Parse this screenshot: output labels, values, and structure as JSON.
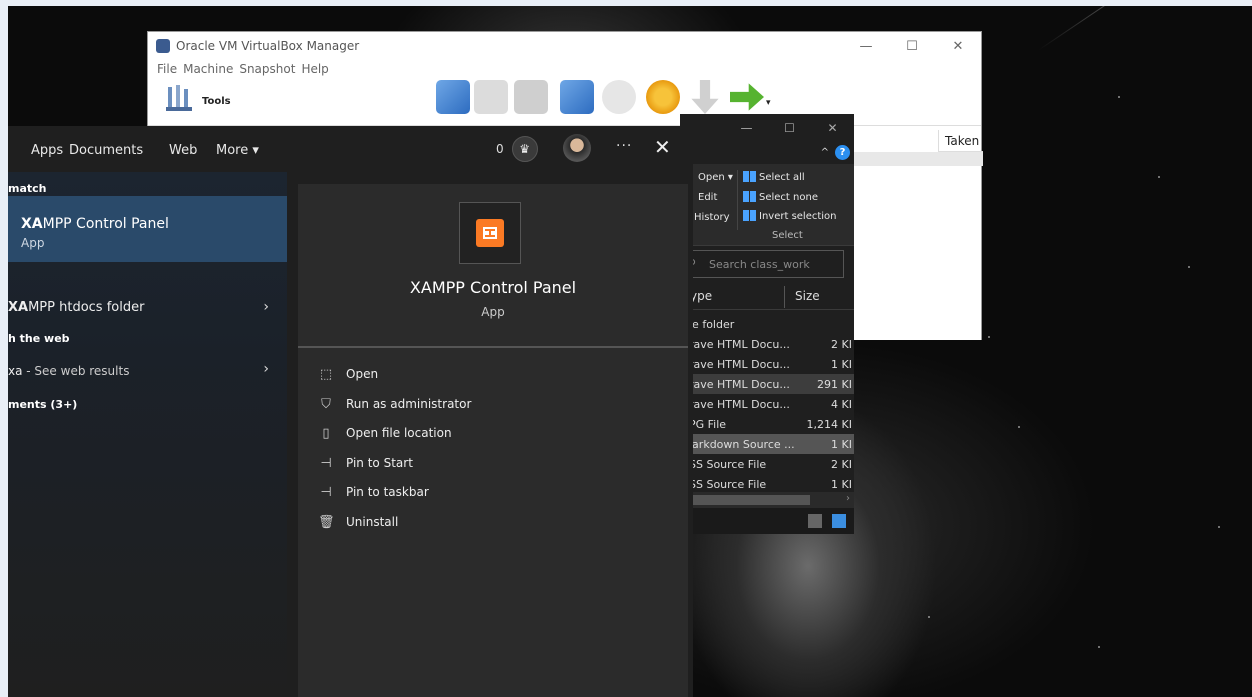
{
  "virtualbox": {
    "title": "Oracle VM VirtualBox Manager",
    "menu": [
      "File",
      "Machine",
      "Snapshot",
      "Help"
    ],
    "tools_label": "Tools",
    "column_header": "Taken",
    "window_controls": [
      "—",
      "☐",
      "✕"
    ]
  },
  "explorer": {
    "window_controls": [
      "—",
      "☐",
      "✕"
    ],
    "ribbon": {
      "open": "Open ▾",
      "edit": "Edit",
      "history": "History",
      "select_all": "Select all",
      "select_none": "Select none",
      "invert_selection": "Invert selection",
      "group": "Select"
    },
    "search_placeholder": "Search class_work",
    "columns": {
      "type": "ype",
      "size": "Size"
    },
    "rows": [
      {
        "type": "le folder",
        "size": ""
      },
      {
        "type": "rave HTML Docu...",
        "size": "2 KI"
      },
      {
        "type": "rave HTML Docu...",
        "size": "1 KI"
      },
      {
        "type": "rave HTML Docu...",
        "size": "291 KI"
      },
      {
        "type": "rave HTML Docu...",
        "size": "4 KI"
      },
      {
        "type": "PG File",
        "size": "1,214 KI"
      },
      {
        "type": "larkdown Source ...",
        "size": "1 KI"
      },
      {
        "type": "SS Source File",
        "size": "2 KI"
      },
      {
        "type": "SS Source File",
        "size": "1 KI"
      }
    ]
  },
  "startmenu": {
    "tabs": [
      "Apps",
      "Documents",
      "Web",
      "More ▾"
    ],
    "points": "0",
    "more_dots": "···",
    "close": "✕",
    "best_match_label": "match",
    "best_match": {
      "title_bold": "XA",
      "title_rest": "MPP Control Panel",
      "subtitle": "App"
    },
    "htdocs": {
      "bold": "XA",
      "rest": "MPP htdocs folder"
    },
    "web_label": "h the web",
    "web_result": {
      "bold": "xa",
      "rest": " - See web results"
    },
    "documents_label": "ments (3+)",
    "detail": {
      "title": "XAMPP Control Panel",
      "subtitle": "App",
      "actions": [
        {
          "icon": "open-icon",
          "label": "Open"
        },
        {
          "icon": "shield-icon",
          "label": "Run as administrator"
        },
        {
          "icon": "file-location-icon",
          "label": "Open file location"
        },
        {
          "icon": "pin-icon",
          "label": "Pin to Start"
        },
        {
          "icon": "pin-icon",
          "label": "Pin to taskbar"
        },
        {
          "icon": "trash-icon",
          "label": "Uninstall"
        }
      ]
    }
  }
}
